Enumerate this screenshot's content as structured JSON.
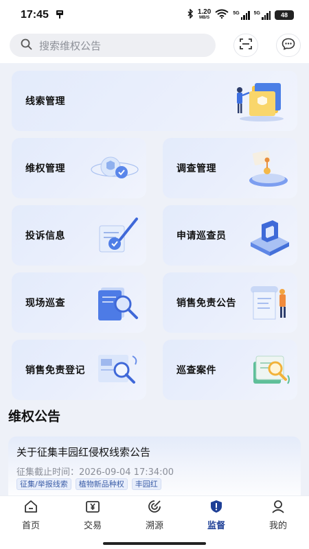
{
  "status_bar": {
    "time": "17:45",
    "net_speed_value": "1.20",
    "net_speed_unit": "MB/S",
    "sim1": "5G",
    "sim2": "5G",
    "battery": "48"
  },
  "search": {
    "placeholder": "搜索维权公告"
  },
  "menu": {
    "clue_management": "线索管理",
    "rights_management": "维权管理",
    "investigation_management": "调查管理",
    "complaint_info": "投诉信息",
    "apply_inspector": "申请巡查员",
    "field_inspection": "现场巡查",
    "sales_exemption_notice": "销售免责公告",
    "sales_exemption_registration": "销售免责登记",
    "inspection_cases": "巡查案件"
  },
  "notice_section": {
    "title": "维权公告",
    "items": [
      {
        "title": "关于征集丰园红侵权线索公告",
        "deadline": "征集截止时间：2026-09-04 17:34:00",
        "tags": [
          "征集/举报线索",
          "植物新品种权",
          "丰园红"
        ]
      }
    ]
  },
  "tabbar": {
    "items": [
      {
        "label": "首页"
      },
      {
        "label": "交易"
      },
      {
        "label": "溯源"
      },
      {
        "label": "监督"
      },
      {
        "label": "我的"
      }
    ],
    "active": "监督"
  },
  "colors": {
    "accent": "#1e3f96",
    "card_bg": "#e6edfb",
    "tag_text": "#3c5ea8"
  }
}
